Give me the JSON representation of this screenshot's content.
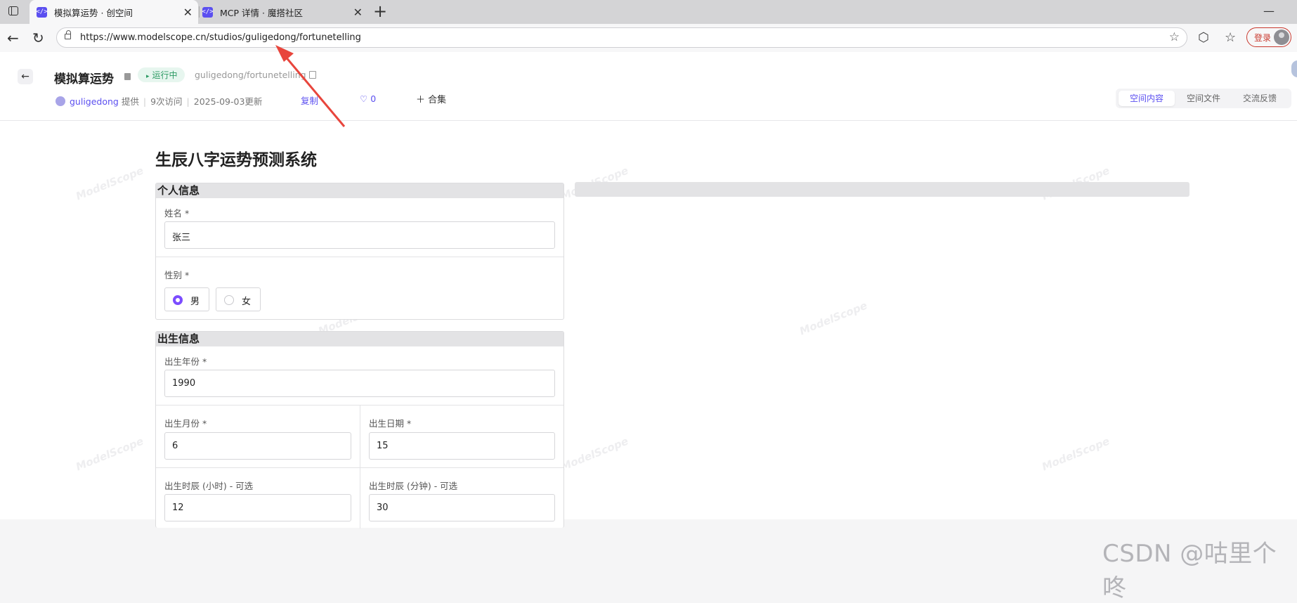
{
  "browser": {
    "tabs": [
      {
        "label": "模拟算运势 · 创空间",
        "active": true
      },
      {
        "label": "MCP 详情 · 魔搭社区",
        "active": false
      }
    ],
    "url": "https://www.modelscope.cn/studios/guligedong/fortunetelling",
    "login_label": "登录"
  },
  "header": {
    "title": "模拟算运势",
    "status": "运行中",
    "repo": "guligedong/fortunetelling",
    "author": "guligedong",
    "provided": "提供",
    "visits": "9次访问",
    "updated": "2025-09-03更新",
    "duplicate": "复制",
    "likes": "0",
    "collection": "合集",
    "tabs": [
      "空间内容",
      "空间文件",
      "交流反馈"
    ],
    "active_tab": "空间内容"
  },
  "watermark_text": "ModelScope",
  "app": {
    "title": "生辰八字运势预测系统",
    "personal": {
      "heading": "个人信息",
      "name_label": "姓名 *",
      "name_value": "张三",
      "gender_label": "性别 *",
      "gender_options": [
        "男",
        "女"
      ],
      "gender_selected": "男"
    },
    "birth": {
      "heading": "出生信息",
      "year_label": "出生年份 *",
      "year_value": "1990",
      "month_label": "出生月份 *",
      "month_value": "6",
      "day_label": "出生日期 *",
      "day_value": "15",
      "hour_label": "出生时辰 (小时) - 可选",
      "hour_value": "12",
      "minute_label": "出生时辰 (分钟) - 可选",
      "minute_value": "30"
    }
  },
  "annotation": {
    "color": "#e8453c"
  },
  "footer_watermark": "CSDN @咕里个咚"
}
